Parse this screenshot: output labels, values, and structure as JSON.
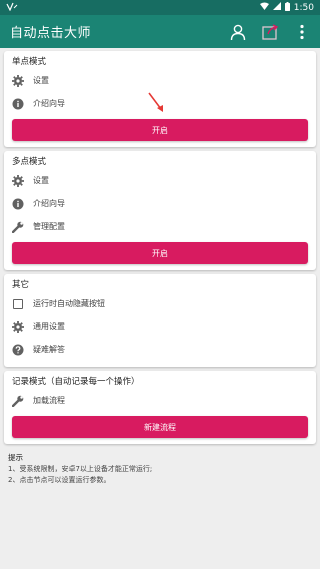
{
  "status_bar": {
    "time": "1:50"
  },
  "app_bar": {
    "title": "自动点击大师"
  },
  "single_mode": {
    "title": "单点模式",
    "items": [
      {
        "label": "设置",
        "icon": "gear-icon"
      },
      {
        "label": "介绍向导",
        "icon": "info-icon"
      }
    ],
    "button": "开启"
  },
  "multi_mode": {
    "title": "多点模式",
    "items": [
      {
        "label": "设置",
        "icon": "gear-icon"
      },
      {
        "label": "介绍向导",
        "icon": "info-icon"
      },
      {
        "label": "管理配置",
        "icon": "wrench-icon"
      }
    ],
    "button": "开启"
  },
  "other": {
    "title": "其它",
    "items": [
      {
        "label": "运行时自动隐藏按钮",
        "icon": "checkbox"
      },
      {
        "label": "通用设置",
        "icon": "gear-icon"
      },
      {
        "label": "疑难解答",
        "icon": "help-icon"
      }
    ]
  },
  "record_mode": {
    "title": "记录模式（自动记录每一个操作）",
    "items": [
      {
        "label": "加载流程",
        "icon": "wrench-icon"
      }
    ],
    "button": "新建流程"
  },
  "tips": {
    "title": "提示",
    "lines": [
      "1、受系统限制，安卓7以上设备才能正常运行;",
      "2、点击节点可以设置运行参数。"
    ]
  },
  "colors": {
    "app_bar": "#1b8474",
    "status_bar": "#176d62",
    "accent": "#d81b60"
  }
}
